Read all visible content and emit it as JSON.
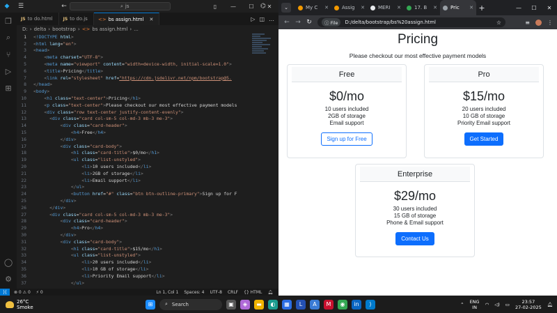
{
  "vscode": {
    "search_text": "js",
    "tabs": [
      {
        "icon": "JS",
        "label": "to do.html"
      },
      {
        "icon": "JS",
        "label": "to do.js"
      },
      {
        "icon": "<>",
        "label": "bs assign.html"
      }
    ],
    "breadcrumb": [
      "D:",
      "delta",
      "bootstrap",
      "bs assign.html",
      "..."
    ],
    "lines": [
      {
        "n": "1",
        "html": "<span class='p'>&lt;</span><span class='t'>!DOCTYPE</span> <span class='a'>html</span><span class='p'>&gt;</span>"
      },
      {
        "n": "2",
        "html": "<span class='p'>&lt;</span><span class='t'>html</span> <span class='a'>lang</span>=<span class='s'>\"en\"</span><span class='p'>&gt;</span>"
      },
      {
        "n": "3",
        "html": "<span class='p'>&lt;</span><span class='t'>head</span><span class='p'>&gt;</span>"
      },
      {
        "n": "4",
        "html": "    <span class='p'>&lt;</span><span class='t'>meta</span> <span class='a'>charset</span>=<span class='s'>\"UTF-8\"</span><span class='p'>&gt;</span>"
      },
      {
        "n": "5",
        "html": "    <span class='p'>&lt;</span><span class='t'>meta</span> <span class='a'>name</span>=<span class='s'>\"viewport\"</span> <span class='a'>content</span>=<span class='s'>\"width=device-width, initial-scale=1.0\"</span><span class='p'>&gt;</span>"
      },
      {
        "n": "6",
        "html": "    <span class='p'>&lt;</span><span class='t'>title</span><span class='p'>&gt;</span>Pricing<span class='p'>&lt;/</span><span class='t'>title</span><span class='p'>&gt;</span>"
      },
      {
        "n": "7",
        "html": "    <span class='p'>&lt;</span><span class='t'>link</span> <span class='a'>rel</span>=<span class='s'>\"stylesheet\"</span> <span class='a'>href</span>=<span class='u'>\"https://cdn.jsdelivr.net/npm/bootstrap@5.</span>"
      },
      {
        "n": "8",
        "html": "<span class='p'>&lt;/</span><span class='t'>head</span><span class='p'>&gt;</span>"
      },
      {
        "n": "9",
        "html": "<span class='p'>&lt;</span><span class='t'>body</span><span class='p'>&gt;</span>"
      },
      {
        "n": "10",
        "html": "    <span class='p'>&lt;</span><span class='t'>h1</span> <span class='a'>class</span>=<span class='s'>\"text-center\"</span><span class='p'>&gt;</span>Pricing<span class='p'>&lt;/</span><span class='t'>h1</span><span class='p'>&gt;</span>"
      },
      {
        "n": "11",
        "html": "    <span class='p'>&lt;</span><span class='t'>p</span> <span class='a'>class</span>=<span class='s'>\"text-center\"</span><span class='p'>&gt;</span>Please checkout our most effective payment models"
      },
      {
        "n": "12",
        "html": "    <span class='p'>&lt;</span><span class='t'>div</span> <span class='a'>class</span>=<span class='s'>\"row text-center justify-content-evenly\"</span><span class='p'>&gt;</span>"
      },
      {
        "n": "13",
        "html": "      <span class='p'>&lt;</span><span class='t'>div</span> <span class='a'>class</span>=<span class='s'>\"card col-sm-5 col-md-3 mb-3 me-3\"</span><span class='p'>&gt;</span>"
      },
      {
        "n": "14",
        "html": "          <span class='p'>&lt;</span><span class='t'>div</span> <span class='a'>class</span>=<span class='s'>\"card-header\"</span><span class='p'>&gt;</span>"
      },
      {
        "n": "15",
        "html": "              <span class='p'>&lt;</span><span class='t'>h4</span><span class='p'>&gt;</span>Free<span class='p'>&lt;/</span><span class='t'>h4</span><span class='p'>&gt;</span>"
      },
      {
        "n": "16",
        "html": "          <span class='p'>&lt;/</span><span class='t'>div</span><span class='p'>&gt;</span>"
      },
      {
        "n": "17",
        "html": "          <span class='p'>&lt;</span><span class='t'>div</span> <span class='a'>class</span>=<span class='s'>\"card-body\"</span><span class='p'>&gt;</span>"
      },
      {
        "n": "18",
        "html": "              <span class='p'>&lt;</span><span class='t'>h1</span> <span class='a'>class</span>=<span class='s'>\"card-title\"</span><span class='p'>&gt;</span>$0/mo<span class='p'>&lt;/</span><span class='t'>h1</span><span class='p'>&gt;</span>"
      },
      {
        "n": "19",
        "html": "              <span class='p'>&lt;</span><span class='t'>ul</span> <span class='a'>class</span>=<span class='s'>\"list-unstyled\"</span><span class='p'>&gt;</span>"
      },
      {
        "n": "20",
        "html": "                  <span class='p'>&lt;</span><span class='t'>li</span><span class='p'>&gt;</span>10 users included<span class='p'>&lt;/</span><span class='t'>li</span><span class='p'>&gt;</span>"
      },
      {
        "n": "21",
        "html": "                  <span class='p'>&lt;</span><span class='t'>li</span><span class='p'>&gt;</span>2GB of storage<span class='p'>&lt;/</span><span class='t'>li</span><span class='p'>&gt;</span>"
      },
      {
        "n": "22",
        "html": "                  <span class='p'>&lt;</span><span class='t'>li</span><span class='p'>&gt;</span>Email support<span class='p'>&lt;/</span><span class='t'>li</span><span class='p'>&gt;</span>"
      },
      {
        "n": "23",
        "html": "              <span class='p'>&lt;/</span><span class='t'>ul</span><span class='p'>&gt;</span>"
      },
      {
        "n": "24",
        "html": "              <span class='p'>&lt;</span><span class='t'>button</span> <span class='a'>href</span>=<span class='s'>\"#\"</span> <span class='a'>class</span>=<span class='s'>\"btn btn-outline-primary\"</span><span class='p'>&gt;</span>Sign up for F"
      },
      {
        "n": "25",
        "html": "          <span class='p'>&lt;/</span><span class='t'>div</span><span class='p'>&gt;</span>"
      },
      {
        "n": "26",
        "html": "      <span class='p'>&lt;/</span><span class='t'>div</span><span class='p'>&gt;</span>"
      },
      {
        "n": "27",
        "html": "      <span class='p'>&lt;</span><span class='t'>div</span> <span class='a'>class</span>=<span class='s'>\"card col-sm-5 col-md-3 mb-3 me-3\"</span><span class='p'>&gt;</span>"
      },
      {
        "n": "28",
        "html": "          <span class='p'>&lt;</span><span class='t'>div</span> <span class='a'>class</span>=<span class='s'>\"card-header\"</span><span class='p'>&gt;</span>"
      },
      {
        "n": "29",
        "html": "              <span class='p'>&lt;</span><span class='t'>h4</span><span class='p'>&gt;</span>Pro<span class='p'>&lt;/</span><span class='t'>h4</span><span class='p'>&gt;</span>"
      },
      {
        "n": "30",
        "html": "          <span class='p'>&lt;/</span><span class='t'>div</span><span class='p'>&gt;</span>"
      },
      {
        "n": "31",
        "html": "          <span class='p'>&lt;</span><span class='t'>div</span> <span class='a'>class</span>=<span class='s'>\"card-body\"</span><span class='p'>&gt;</span>"
      },
      {
        "n": "32",
        "html": "              <span class='p'>&lt;</span><span class='t'>h1</span> <span class='a'>class</span>=<span class='s'>\"card-title\"</span><span class='p'>&gt;</span>$15/mo<span class='p'>&lt;/</span><span class='t'>h1</span><span class='p'>&gt;</span>"
      },
      {
        "n": "33",
        "html": "              <span class='p'>&lt;</span><span class='t'>ul</span> <span class='a'>class</span>=<span class='s'>\"list-unstyled\"</span><span class='p'>&gt;</span>"
      },
      {
        "n": "34",
        "html": "                  <span class='p'>&lt;</span><span class='t'>li</span><span class='p'>&gt;</span>20 users included<span class='p'>&lt;/</span><span class='t'>li</span><span class='p'>&gt;</span>"
      },
      {
        "n": "35",
        "html": "                  <span class='p'>&lt;</span><span class='t'>li</span><span class='p'>&gt;</span>10 GB of storage<span class='p'>&lt;/</span><span class='t'>li</span><span class='p'>&gt;</span>"
      },
      {
        "n": "36",
        "html": "                  <span class='p'>&lt;</span><span class='t'>li</span><span class='p'>&gt;</span>Priority Email support<span class='p'>&lt;/</span><span class='t'>li</span><span class='p'>&gt;</span>"
      },
      {
        "n": "37",
        "html": "              <span class='p'>&lt;/</span><span class='t'>ul</span><span class='p'>&gt;</span>"
      }
    ],
    "status": {
      "problems": "⊗ 0 ⚠ 0",
      "ports": "⚡ 0",
      "position": "Ln 1, Col 1",
      "spaces": "Spaces: 4",
      "encoding": "UTF-8",
      "eol": "CRLF",
      "language": "{} HTML"
    }
  },
  "chrome": {
    "tabs": [
      {
        "label": "My C",
        "color": "#f29900"
      },
      {
        "label": "Assig",
        "color": "#f29900"
      },
      {
        "label": "MERI",
        "color": "#e8eaed"
      },
      {
        "label": "17. B",
        "color": "#34a853"
      },
      {
        "label": "Pric",
        "color": "#9aa0a6"
      }
    ],
    "file_badge": "File",
    "address": "D:/delta/bootstrap/bs%20assign.html"
  },
  "page": {
    "title": "Pricing",
    "subtitle": "Please checkout our most effective payment models",
    "cards": [
      {
        "name": "Free",
        "price": "$0/mo",
        "features": [
          "10 users included",
          "2GB of storage",
          "Email support"
        ],
        "button": "Sign up for Free"
      },
      {
        "name": "Pro",
        "price": "$15/mo",
        "features": [
          "20 users included",
          "10 GB of storage",
          "Priority Email support"
        ],
        "button": "Get Started"
      },
      {
        "name": "Enterprise",
        "price": "$29/mo",
        "features": [
          "30 users included",
          "15 GB of storage",
          "Phone & Email support"
        ],
        "button": "Contact Us"
      }
    ]
  },
  "taskbar": {
    "weather_temp": "26°C",
    "weather_desc": "Smoke",
    "weather_badge": "6",
    "search": "Search",
    "lang_1": "ENG",
    "lang_2": "IN",
    "time": "23:57",
    "date": "27-02-2025"
  }
}
